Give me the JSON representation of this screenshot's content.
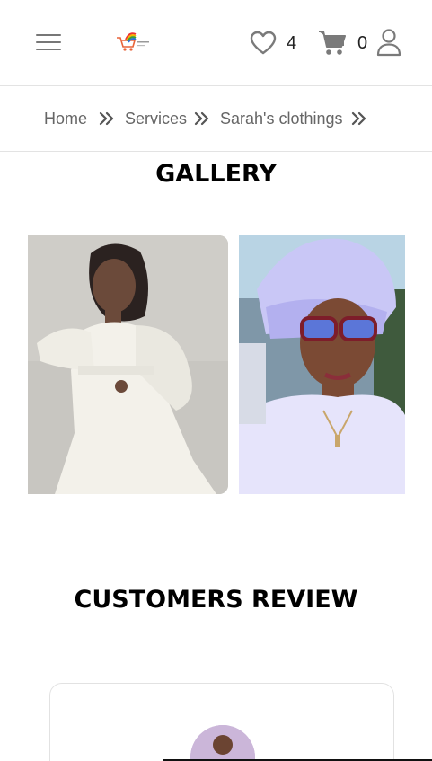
{
  "header": {
    "wishlist_count": "4",
    "cart_count": "0"
  },
  "breadcrumb": {
    "items": [
      "Home",
      "Services",
      "Sarah's clothings"
    ]
  },
  "gallery": {
    "title": "GALLERY"
  },
  "reviews": {
    "title": "CUSTOMERS REVIEW"
  },
  "colors": {
    "icon_gray": "#7a7a7a",
    "divider": "#e3e3e3",
    "card_border": "#e2e2e2"
  },
  "icons": [
    "menu-icon",
    "heart-icon",
    "cart-icon",
    "user-icon",
    "chevron-double-right-icon"
  ]
}
